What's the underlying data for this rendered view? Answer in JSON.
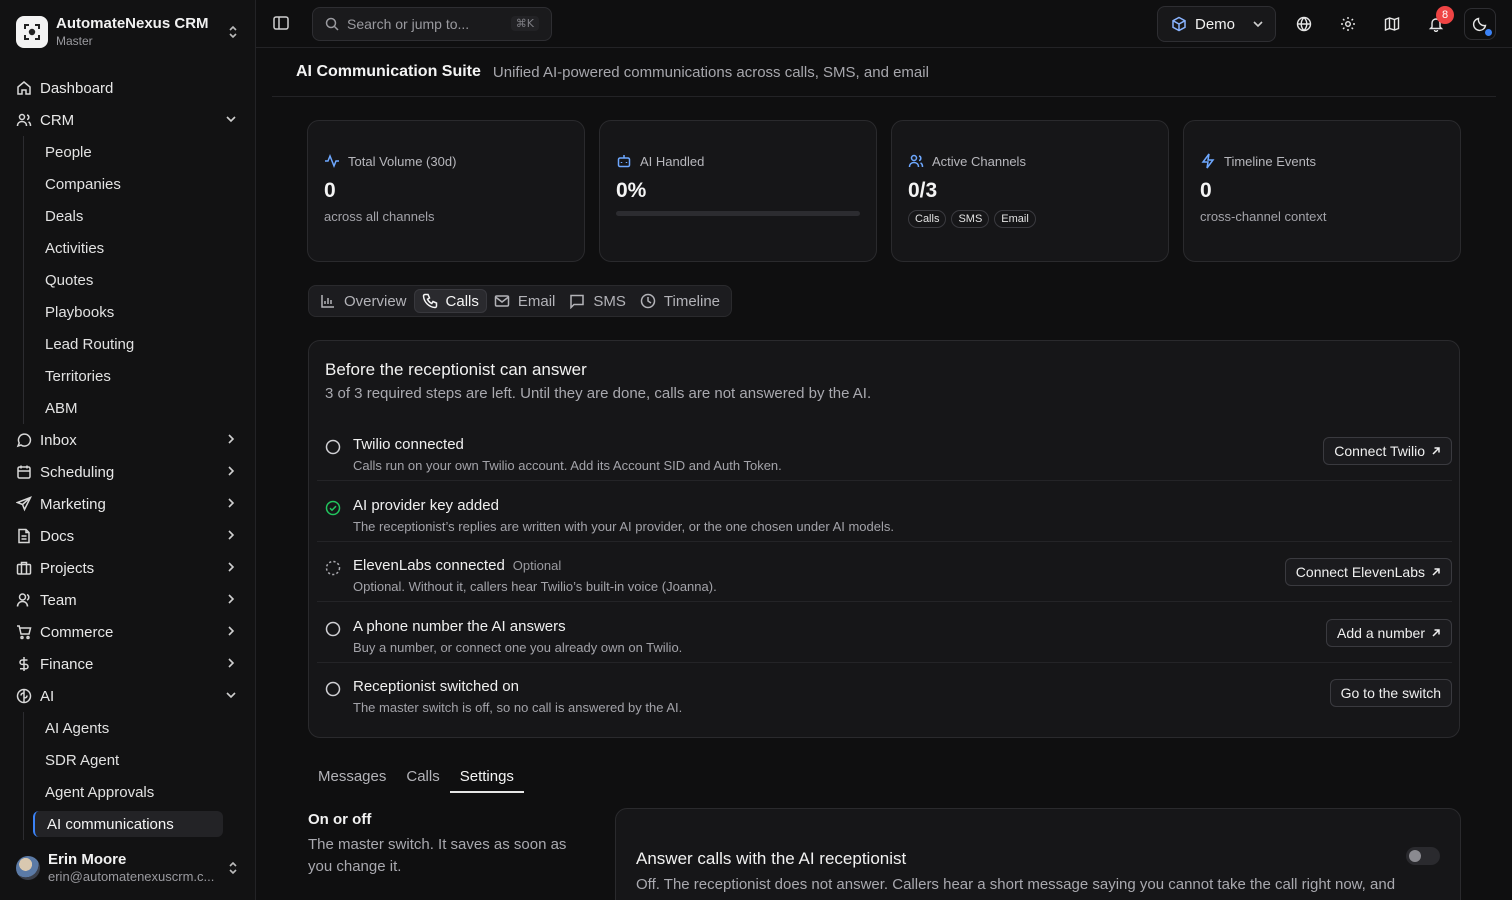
{
  "brand": {
    "name": "AutomateNexus CRM",
    "sub": "Master"
  },
  "nav": {
    "dashboard": "Dashboard",
    "crm": "CRM",
    "crm_items": [
      "People",
      "Companies",
      "Deals",
      "Activities",
      "Quotes",
      "Playbooks",
      "Lead Routing",
      "Territories",
      "ABM"
    ],
    "inbox": "Inbox",
    "scheduling": "Scheduling",
    "marketing": "Marketing",
    "docs": "Docs",
    "projects": "Projects",
    "team": "Team",
    "commerce": "Commerce",
    "finance": "Finance",
    "ai": "AI",
    "ai_items": [
      "AI Agents",
      "SDR Agent",
      "Agent Approvals",
      "AI communications"
    ]
  },
  "user": {
    "name": "Erin Moore",
    "email": "erin@automatenexuscrm.c..."
  },
  "topbar": {
    "search_placeholder": "Search or jump to...",
    "search_shortcut": "⌘K",
    "workspace": "Demo",
    "notifications_count": "8"
  },
  "page": {
    "title": "AI Communication Suite",
    "subtitle": "Unified AI-powered communications across calls, SMS, and email"
  },
  "stats": [
    {
      "label": "Total Volume (30d)",
      "value": "0",
      "sub": "across all channels"
    },
    {
      "label": "AI Handled",
      "value": "0%",
      "progress": 0
    },
    {
      "label": "Active Channels",
      "value": "0/3",
      "chips": [
        "Calls",
        "SMS",
        "Email"
      ]
    },
    {
      "label": "Timeline Events",
      "value": "0",
      "sub": "cross-channel context"
    }
  ],
  "tabs": [
    "Overview",
    "Calls",
    "Email",
    "SMS",
    "Timeline"
  ],
  "active_tab": "Calls",
  "setup": {
    "title": "Before the receptionist can answer",
    "subtitle": "3 of 3 required steps are left. Until they are done, calls are not answered by the AI.",
    "steps": [
      {
        "title": "Twilio connected",
        "desc": "Calls run on your own Twilio account. Add its Account SID and Auth Token.",
        "button": "Connect Twilio",
        "status": "todo"
      },
      {
        "title": "AI provider key added",
        "desc": "The receptionist’s replies are written with your AI provider, or the one chosen under AI models.",
        "status": "done"
      },
      {
        "title": "ElevenLabs connected",
        "optional": "Optional",
        "desc": "Optional. Without it, callers hear Twilio’s built-in voice (Joanna).",
        "button": "Connect ElevenLabs",
        "status": "optional"
      },
      {
        "title": "A phone number the AI answers",
        "desc": "Buy a number, or connect one you already own on Twilio.",
        "button": "Add a number",
        "status": "todo"
      },
      {
        "title": "Receptionist switched on",
        "desc": "The master switch is off, so no call is answered by the AI.",
        "button": "Go to the switch",
        "status": "todo"
      }
    ]
  },
  "subtabs": [
    "Messages",
    "Calls",
    "Settings"
  ],
  "active_subtab": "Settings",
  "settings": {
    "section_title": "On or off",
    "section_desc": "The master switch. It saves as soon as you change it.",
    "panel_title": "Answer calls with the AI receptionist",
    "panel_desc": "Off. The receptionist does not answer. Callers hear a short message saying you cannot take the call right now, and",
    "enabled": false
  },
  "colors": {
    "accent": "#6ea8ff",
    "badge": "#ef4444",
    "done": "#22c55e"
  }
}
